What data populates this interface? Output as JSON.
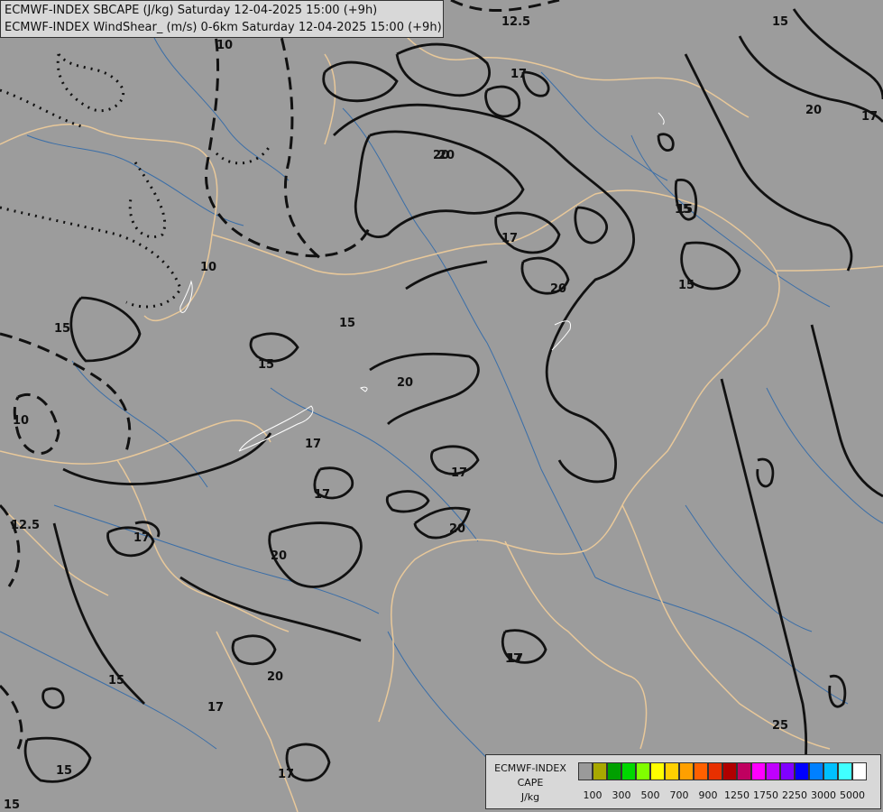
{
  "header": {
    "line1": "ECMWF-INDEX SBCAPE (J/kg) Saturday 12-04-2025 15:00 (+9h)",
    "line2": "ECMWF-INDEX WindShear_ (m/s) 0-6km Saturday 12-04-2025 15:00 (+9h)"
  },
  "legend": {
    "title_lines": [
      "ECMWF-INDEX",
      "CAPE",
      "J/kg"
    ],
    "colors": [
      "#9a9a9a",
      "#a8a800",
      "#00a000",
      "#00d800",
      "#80ff00",
      "#ffff00",
      "#ffd000",
      "#ffa000",
      "#ff6000",
      "#e83000",
      "#b00000",
      "#c00060",
      "#ff00ff",
      "#c000ff",
      "#8000ff",
      "#0000ff",
      "#0080ff",
      "#00c0ff",
      "#40ffff",
      "#ffffff"
    ],
    "ticks": [
      "100",
      "300",
      "500",
      "700",
      "900",
      "1250",
      "1750",
      "2250",
      "3000",
      "5000"
    ]
  },
  "contour_labels": [
    "12.5",
    "15",
    "17",
    "20",
    "10",
    "15",
    "20",
    "17",
    "15",
    "17",
    "20",
    "17",
    "15",
    "15",
    "20",
    "15",
    "17",
    "20",
    "17",
    "17",
    "20",
    "17",
    "10",
    "15",
    "17",
    "20",
    "15",
    "17",
    "17",
    "25",
    "15",
    "10",
    "12.5",
    "17",
    "15",
    "20"
  ]
}
